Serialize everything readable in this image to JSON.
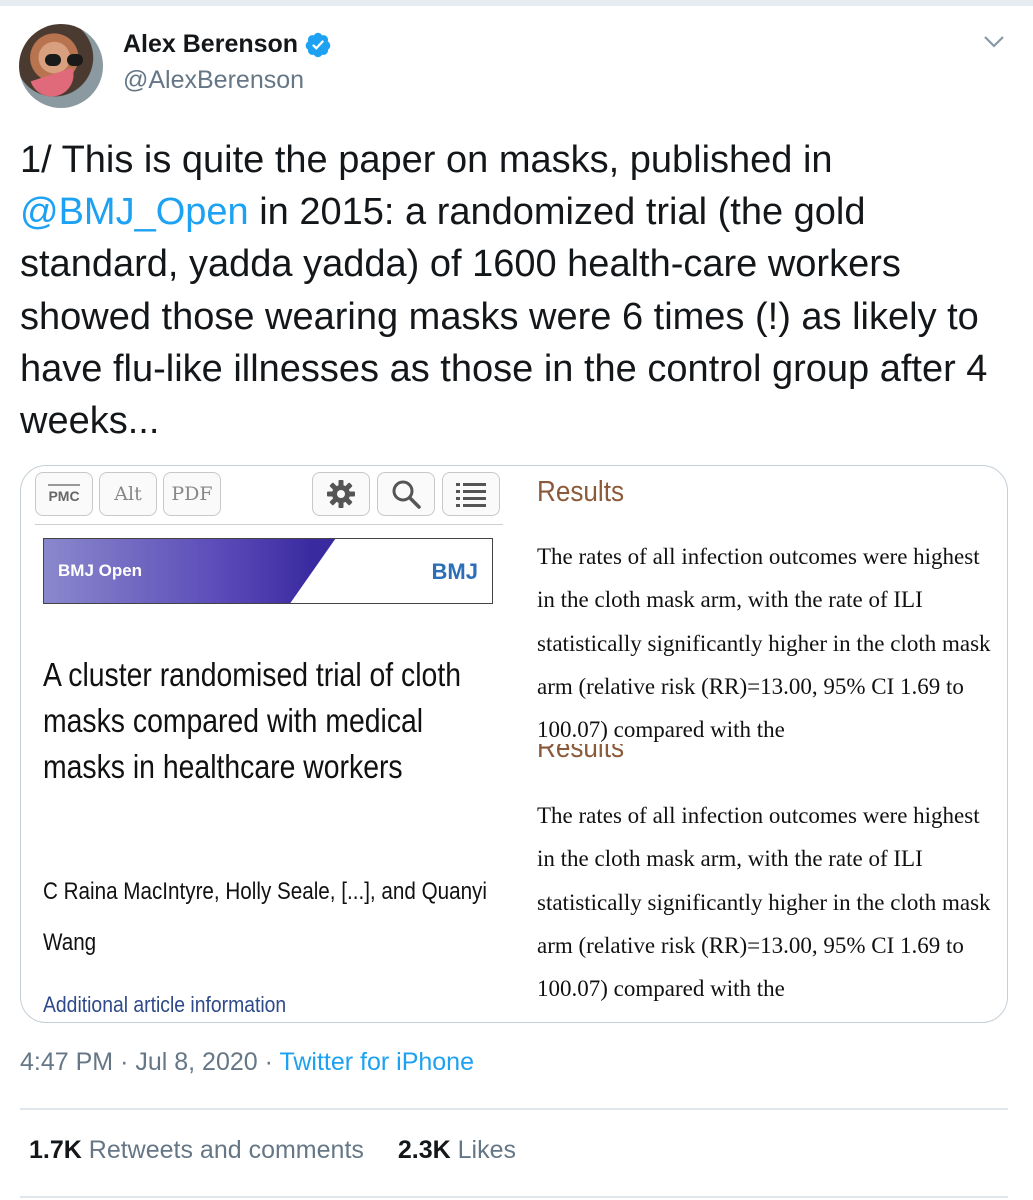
{
  "author": {
    "name": "Alex Berenson",
    "handle": "@AlexBerenson"
  },
  "tweet": {
    "text_before": "1/ This is quite the paper on masks, published in ",
    "mention": "@BMJ_Open",
    "text_after": " in 2015: a randomized trial (the gold standard, yadda yadda) of 1600 health-care workers showed those wearing masks were 6 times (!) as likely to have flu-like illnesses as those in the control group after 4 weeks..."
  },
  "card": {
    "toolbar": {
      "pmc": "PMC",
      "alt": "Alt",
      "pdf": "PDF"
    },
    "journal_name": "BMJ Open",
    "journal_logo": "BMJ",
    "article_title": "A cluster randomised trial of cloth masks compared with medical masks in healthcare workers",
    "authors": "C Raina MacIntyre, Holly Seale, [...], and Quanyi Wang",
    "additional_link": "Additional article information",
    "results_heading": "Results",
    "results_text": "The rates of all infection outcomes were highest in the cloth mask arm, with the rate of ILI statistically significantly higher in the cloth mask arm (relative risk (RR)=13.00, 95% CI 1.69 to 100.07) compared with the"
  },
  "meta": {
    "time": "4:47 PM",
    "date": "Jul 8, 2020",
    "source": "Twitter for iPhone"
  },
  "stats": {
    "retweets_count": "1.7K",
    "retweets_label": "Retweets and comments",
    "likes_count": "2.3K",
    "likes_label": "Likes"
  },
  "colors": {
    "link": "#1da1f2",
    "secondary_text": "#657786",
    "results_heading": "#8b5a3a"
  }
}
